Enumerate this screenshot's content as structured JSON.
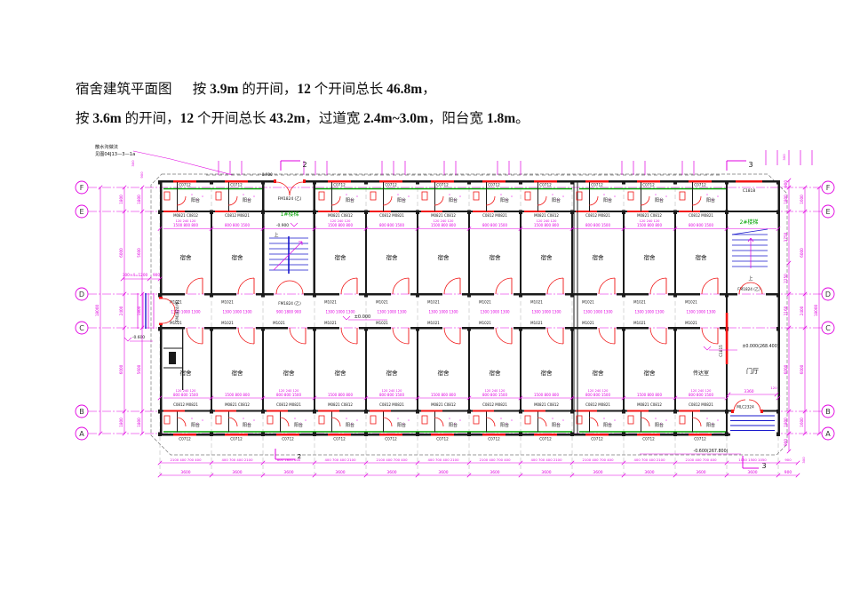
{
  "caption": {
    "line1": [
      {
        "t": "宿舍建筑平面图",
        "b": false
      },
      {
        "t": "      按 ",
        "b": false
      },
      {
        "t": "3.9m",
        "b": true
      },
      {
        "t": " 的开间，",
        "b": false
      },
      {
        "t": "12",
        "b": true
      },
      {
        "t": " 个开间总长 ",
        "b": false
      },
      {
        "t": "46.8m",
        "b": true
      },
      {
        "t": "，",
        "b": false
      }
    ],
    "line2": [
      {
        "t": "按 ",
        "b": false
      },
      {
        "t": "3.6m",
        "b": true
      },
      {
        "t": " 的开间，",
        "b": false
      },
      {
        "t": "12",
        "b": true
      },
      {
        "t": " 个开间总长 ",
        "b": false
      },
      {
        "t": "43.2m",
        "b": true
      },
      {
        "t": "，过道宽 ",
        "b": false
      },
      {
        "t": "2.4m~3.0m",
        "b": true
      },
      {
        "t": "，阳台宽 ",
        "b": false
      },
      {
        "t": "1.8m",
        "b": true
      },
      {
        "t": "。",
        "b": false
      }
    ]
  },
  "grid_letters": [
    "F",
    "E",
    "D",
    "C",
    "B",
    "A"
  ],
  "texts": {
    "room": "宿舍",
    "reception": "传达室",
    "hall": "门厅",
    "balcony": "阳台",
    "up": "上",
    "stair1_name": "1#楼梯",
    "stair2_name": "2#楼梯",
    "door_fm": "FM1824 (乙)",
    "door_fm_left": "FM1824(甲)",
    "door_m": "M1021",
    "door_mlc": "MLC2324",
    "win_c0712": "C0712",
    "win_c1818": "C1818",
    "win_c1815": "C1815",
    "pair_a": "M0821 C0812",
    "pair_b": "C0812 M0821",
    "elev_m09": "-0.900",
    "elev_0": "±0.000",
    "elev_0_abs": "±0.000(268.400)",
    "elev_m06": "-0.600",
    "elev_m06_abs": "-0.600(267.800)",
    "note1": "散水沟做法",
    "note2": "见图04J13—3—1a",
    "steps_note": "300×4=1200",
    "steps_w": "900",
    "marker2": "2",
    "marker3": "3"
  },
  "dims": {
    "room_a": "1500 800 800",
    "room_b": "800 800 1500",
    "room_small": "120 240 120",
    "corridor": "1300 1000 1300",
    "corridor_stair": "900 1800 900",
    "hall_w": "3360",
    "hall_120": "120",
    "bottom_a": "2100 400 700 400",
    "bottom_b": "400 700 400 2100",
    "bottom_stair": "600 1800 600",
    "bottom_end": "1050 1500 1050",
    "bottom_900": "900",
    "bay": "3600",
    "left_outer": [
      "1800",
      "6000",
      "2400",
      "6000",
      "1800"
    ],
    "left_inner": [
      "1800",
      "5600",
      "1800",
      "5600",
      "1800"
    ],
    "left_total": "18000",
    "right_inner": [
      "900",
      "1800",
      "3750",
      "2250",
      "2160",
      "6000",
      "1800",
      "900"
    ],
    "right_outer": [
      "1600",
      "6000",
      "2400",
      "6000",
      "1600"
    ],
    "right_total": "18000",
    "small_300": "300",
    "small_900": "900"
  },
  "colors": {
    "dim": "#e100e1",
    "wall": "#1a1a1a",
    "red": "#f01515",
    "green": "#00a300",
    "blue": "#1818cc",
    "gray": "#777777"
  }
}
